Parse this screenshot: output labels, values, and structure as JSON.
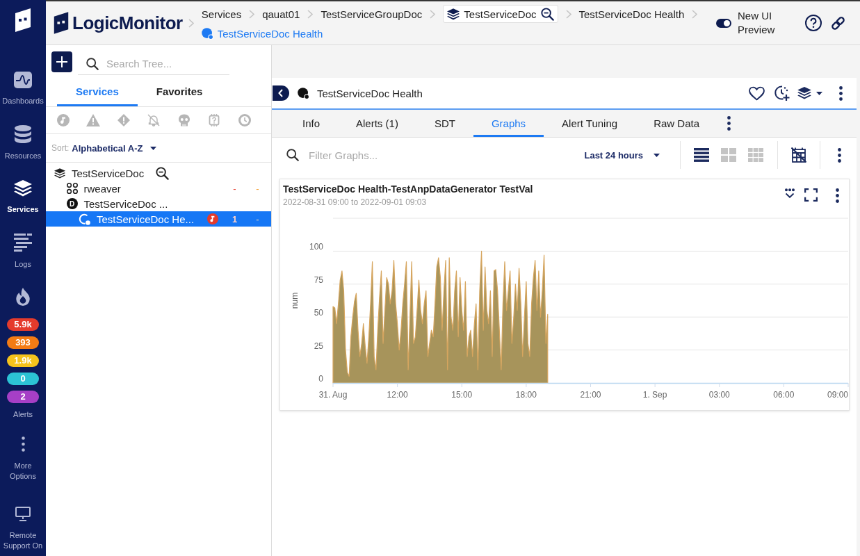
{
  "nav": {
    "items": [
      {
        "label": "Dashboards",
        "selected": false
      },
      {
        "label": "Resources",
        "selected": false
      },
      {
        "label": "Services",
        "selected": true
      },
      {
        "label": "Logs",
        "selected": false
      }
    ],
    "alerts": {
      "label": "Alerts",
      "badges": [
        {
          "count": "5.9k",
          "color": "#e53b2c"
        },
        {
          "count": "393",
          "color": "#f47b14"
        },
        {
          "count": "1.9k",
          "color": "#f6c31c"
        },
        {
          "count": "0",
          "color": "#2cc3d5"
        },
        {
          "count": "2",
          "color": "#a63fc6"
        }
      ]
    },
    "more": {
      "label": "More Options"
    },
    "remote": {
      "label": "Remote Support On"
    }
  },
  "header": {
    "brand": "LogicMonitor",
    "breadcrumbs": [
      {
        "label": "Services",
        "kind": "link"
      },
      {
        "label": "qauat01",
        "kind": "link"
      },
      {
        "label": "TestServiceGroupDoc",
        "kind": "link"
      },
      {
        "label": "TestServiceDoc",
        "kind": "boxed"
      },
      {
        "label": "TestServiceDoc Health",
        "kind": "link"
      }
    ],
    "current": "TestServiceDoc Health",
    "preview_toggle": {
      "label": "New UI Preview",
      "on": true
    }
  },
  "tree_panel": {
    "search": {
      "placeholder": "Search Tree..."
    },
    "tabs": [
      {
        "label": "Services",
        "selected": true
      },
      {
        "label": "Favorites",
        "selected": false
      }
    ],
    "sort": {
      "label": "Sort:",
      "value": "Alphabetical A-Z"
    },
    "tree": [
      {
        "label": "TestServiceDoc",
        "kind": "group",
        "selected": false,
        "alerting": false,
        "children": [
          {
            "label": "rweaver",
            "kind": "collector",
            "selected": false,
            "alerting": false,
            "counts": [
              "-",
              "-"
            ]
          },
          {
            "label": "TestServiceDoc ...",
            "kind": "device",
            "letter": "D",
            "selected": false,
            "alerting": false,
            "children": [
              {
                "label": "TestServiceDoc He...",
                "kind": "service",
                "selected": true,
                "alerting": true,
                "counts": [
                  "1",
                  "-"
                ]
              }
            ]
          }
        ]
      }
    ]
  },
  "detail": {
    "title": "TestServiceDoc Health",
    "tabs": [
      {
        "label": "Info",
        "selected": false
      },
      {
        "label": "Alerts (1)",
        "selected": false
      },
      {
        "label": "SDT",
        "selected": false
      },
      {
        "label": "Graphs",
        "selected": true
      },
      {
        "label": "Alert Tuning",
        "selected": false
      },
      {
        "label": "Raw Data",
        "selected": false
      }
    ],
    "filter": {
      "placeholder": "Filter Graphs..."
    },
    "time_range": "Last 24 hours",
    "layouts": [
      {
        "kind": "list",
        "selected": true
      },
      {
        "kind": "grid-2",
        "selected": false
      },
      {
        "kind": "grid-3",
        "selected": false
      }
    ],
    "graph": {
      "title": "TestServiceDoc Health-TestAnpDataGenerator TestVal",
      "subtitle": "2022-08-31 09:00 to 2022-09-01 09:03",
      "chart_data": {
        "type": "area",
        "ylabel": "num",
        "grid": true,
        "categories": [
          "31. Aug",
          null,
          null,
          null,
          null,
          null,
          null,
          null,
          null,
          null,
          null,
          null,
          null,
          null,
          null,
          null,
          null,
          null,
          null,
          null,
          null,
          null,
          null,
          null,
          null,
          null,
          null,
          null,
          null,
          null,
          null,
          null,
          null,
          null,
          null,
          null,
          "12:00",
          null,
          null,
          null,
          null,
          null,
          null,
          null,
          null,
          null,
          null,
          null,
          null,
          null,
          null,
          null,
          null,
          null,
          null,
          null,
          null,
          null,
          null,
          null,
          null,
          null,
          null,
          null,
          null,
          null,
          null,
          null,
          null,
          null,
          null,
          null,
          "15:00",
          null,
          null,
          null,
          null,
          null,
          null,
          null,
          null,
          null,
          null,
          null,
          null,
          null,
          null,
          null,
          null,
          null,
          null,
          null,
          null,
          null,
          null,
          null,
          null,
          null,
          null,
          null,
          null,
          null,
          null,
          null,
          null,
          null,
          null,
          null,
          "18:00",
          null,
          null,
          null,
          null,
          null,
          null,
          null,
          null,
          null,
          null,
          null,
          null,
          null,
          null,
          null,
          null,
          null,
          null,
          null,
          null,
          null,
          null,
          null,
          null,
          null,
          null,
          null,
          null,
          null,
          null,
          null,
          null,
          null,
          null,
          null,
          "21:00",
          null,
          null,
          null,
          null,
          null,
          null,
          null,
          null,
          null,
          null,
          null,
          null,
          null,
          null,
          null,
          null,
          null,
          null,
          null,
          null,
          null,
          null,
          null,
          null,
          null,
          null,
          null,
          null,
          null,
          null,
          null,
          null,
          null,
          null,
          null,
          "1. Sep",
          null,
          null,
          null,
          null,
          null,
          null,
          null,
          null,
          null,
          null,
          null,
          null,
          null,
          null,
          null,
          null,
          null,
          null,
          null,
          null,
          null,
          null,
          null,
          null,
          null,
          null,
          null,
          null,
          null,
          null,
          null,
          null,
          null,
          null,
          null,
          "03:00",
          null,
          null,
          null,
          null,
          null,
          null,
          null,
          null,
          null,
          null,
          null,
          null,
          null,
          null,
          null,
          null,
          null,
          null,
          null,
          null,
          null,
          null,
          null,
          null,
          null,
          null,
          null,
          null,
          null,
          null,
          null,
          null,
          null,
          null,
          null,
          "06:00",
          null,
          null,
          null,
          null,
          null,
          null,
          null,
          null,
          null,
          null,
          null,
          null,
          null,
          null,
          null,
          null,
          null,
          null,
          null,
          null,
          null,
          null,
          null,
          null,
          null,
          null,
          null,
          null,
          null,
          null,
          null,
          null,
          null,
          null,
          null,
          "09:00"
        ],
        "series": [
          {
            "color": "#d6a55e",
            "values": [
              58,
              57,
              45,
              60,
              78,
              85,
              70,
              25,
              8,
              5,
              35,
              50,
              62,
              68,
              40,
              20,
              30,
              45,
              28,
              15,
              35,
              60,
              92,
              20,
              10,
              40,
              65,
              85,
              30,
              55,
              80,
              75,
              60,
              70,
              93,
              60,
              45,
              25,
              40,
              60,
              75,
              92,
              10,
              50,
              92,
              30,
              35,
              55,
              78,
              55,
              45,
              60,
              70,
              20,
              30,
              40,
              35,
              60,
              88,
              95,
              80,
              40,
              70,
              93,
              10,
              95,
              50,
              40,
              70,
              85,
              35,
              80,
              55,
              40,
              77,
              20,
              35,
              40,
              20,
              45,
              60,
              10,
              70,
              100,
              40,
              88,
              55,
              45,
              70,
              20,
              85,
              86,
              70,
              40,
              10,
              60,
              92,
              55,
              70,
              85,
              30,
              50,
              75,
              55,
              87,
              60,
              20,
              50,
              77,
              30,
              20,
              60,
              80,
              93,
              55,
              85,
              50,
              70,
              97,
              30,
              52,
              null,
              null,
              null,
              null,
              null,
              null,
              null,
              null,
              null,
              null,
              null,
              null,
              null,
              null,
              null,
              null,
              null,
              null,
              null,
              null,
              null,
              null,
              null,
              null,
              null,
              null,
              null,
              null,
              null,
              null,
              null,
              null,
              null,
              null,
              null,
              null,
              null,
              null,
              null,
              null,
              null,
              null,
              null,
              null,
              null,
              null,
              null,
              null,
              null,
              null,
              null,
              null,
              null,
              null,
              null,
              null,
              null,
              null,
              null,
              null,
              null,
              null,
              null,
              null,
              null,
              null,
              null,
              null,
              null,
              null,
              null,
              null,
              null,
              null,
              null,
              null,
              null,
              null,
              null,
              null,
              null,
              null,
              null,
              null,
              null,
              null,
              null,
              null,
              null,
              null,
              null,
              null,
              null,
              null,
              null,
              null,
              null,
              null,
              null,
              null,
              null,
              null,
              null,
              null,
              null,
              null,
              null,
              null,
              null,
              null,
              null,
              null,
              null,
              null,
              null,
              null,
              null,
              null,
              null,
              null,
              null,
              null,
              null,
              null,
              null,
              null,
              null,
              null,
              null,
              null,
              null,
              null,
              null,
              null,
              null,
              null,
              null,
              null,
              null,
              null,
              null,
              null,
              null,
              null,
              null,
              null,
              null,
              null,
              null,
              null,
              null,
              null,
              null,
              null,
              null,
              null,
              null,
              null,
              null,
              null,
              null,
              null,
              null,
              null,
              null,
              null,
              null,
              null
            ]
          }
        ],
        "ylim": [
          0,
          125
        ],
        "yticks": [
          0,
          25,
          50,
          75,
          100
        ]
      }
    }
  }
}
